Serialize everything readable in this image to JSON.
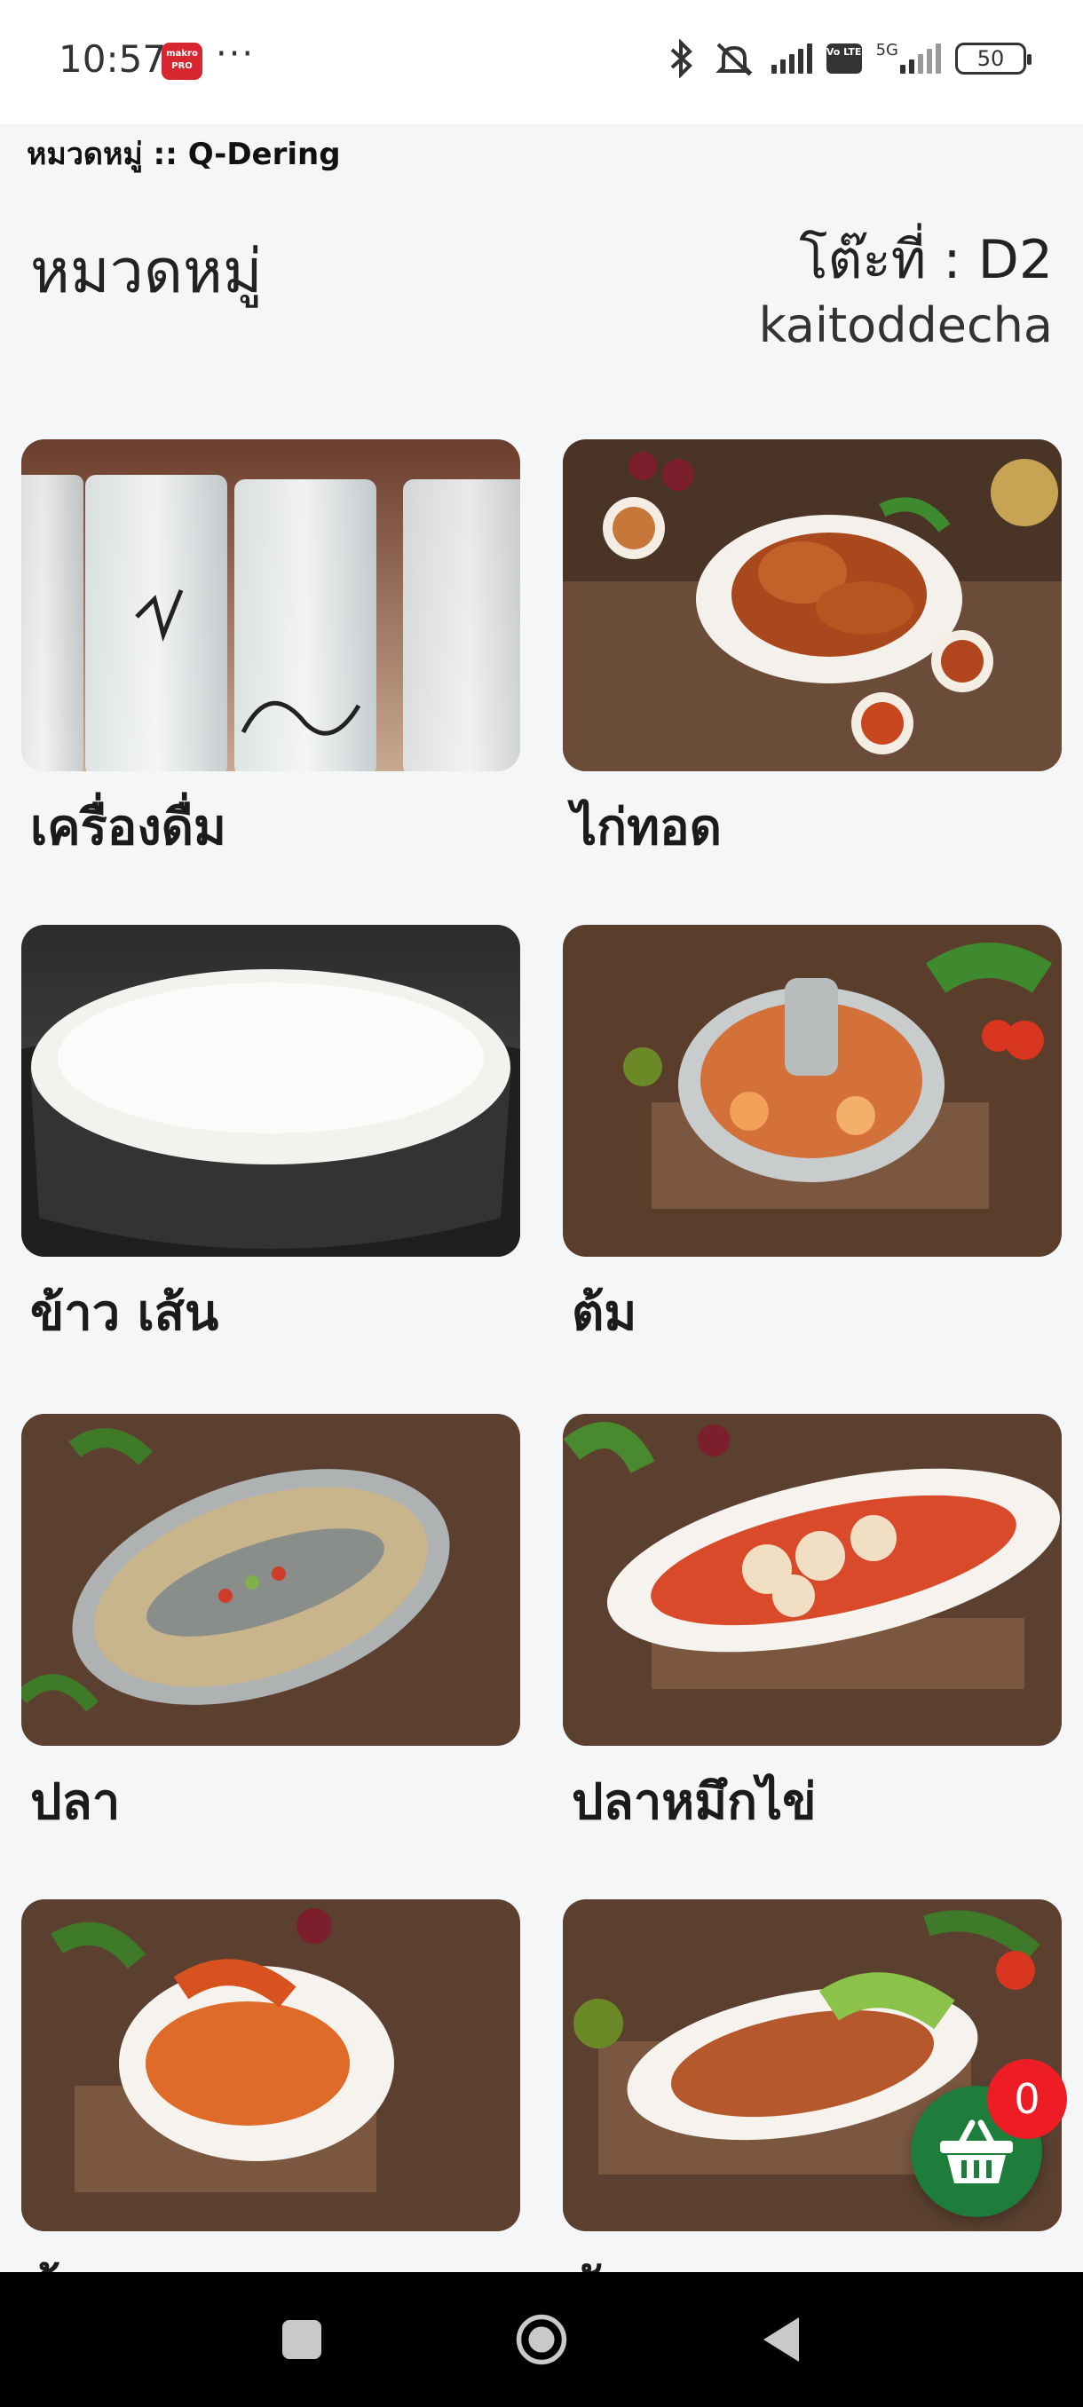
{
  "status_bar": {
    "time": "10:57",
    "makro_badge": "makro PRO",
    "more": "···",
    "network": "5G",
    "volte": "Vo LTE",
    "battery": "50"
  },
  "page_title": "หมวดหมู่ :: Q-Dering",
  "header": {
    "title": "หมวดหมู่",
    "table_label": "โต๊ะที่ : D2",
    "username": "kaitoddecha"
  },
  "categories": [
    {
      "name": "เครื่องดื่ม",
      "image": "drinks-photo"
    },
    {
      "name": "ไก่ทอด",
      "image": "fried-chicken-photo"
    },
    {
      "name": "ข้าว เส้น",
      "image": "rice-photo"
    },
    {
      "name": "ต้ม",
      "image": "tom-yum-photo"
    },
    {
      "name": "ปลา",
      "image": "steamed-fish-photo"
    },
    {
      "name": "ปลาหมึกไข่",
      "image": "squid-photo"
    },
    {
      "name": "กุ้ง",
      "image": "shrimp-photo"
    },
    {
      "name": "ผัด",
      "image": "stir-fry-photo"
    }
  ],
  "cart": {
    "count": "0",
    "icon": "basket-icon"
  },
  "colors": {
    "accent": "#1e7d3a",
    "badge": "#ee1c25",
    "background": "#f5f6f8"
  }
}
